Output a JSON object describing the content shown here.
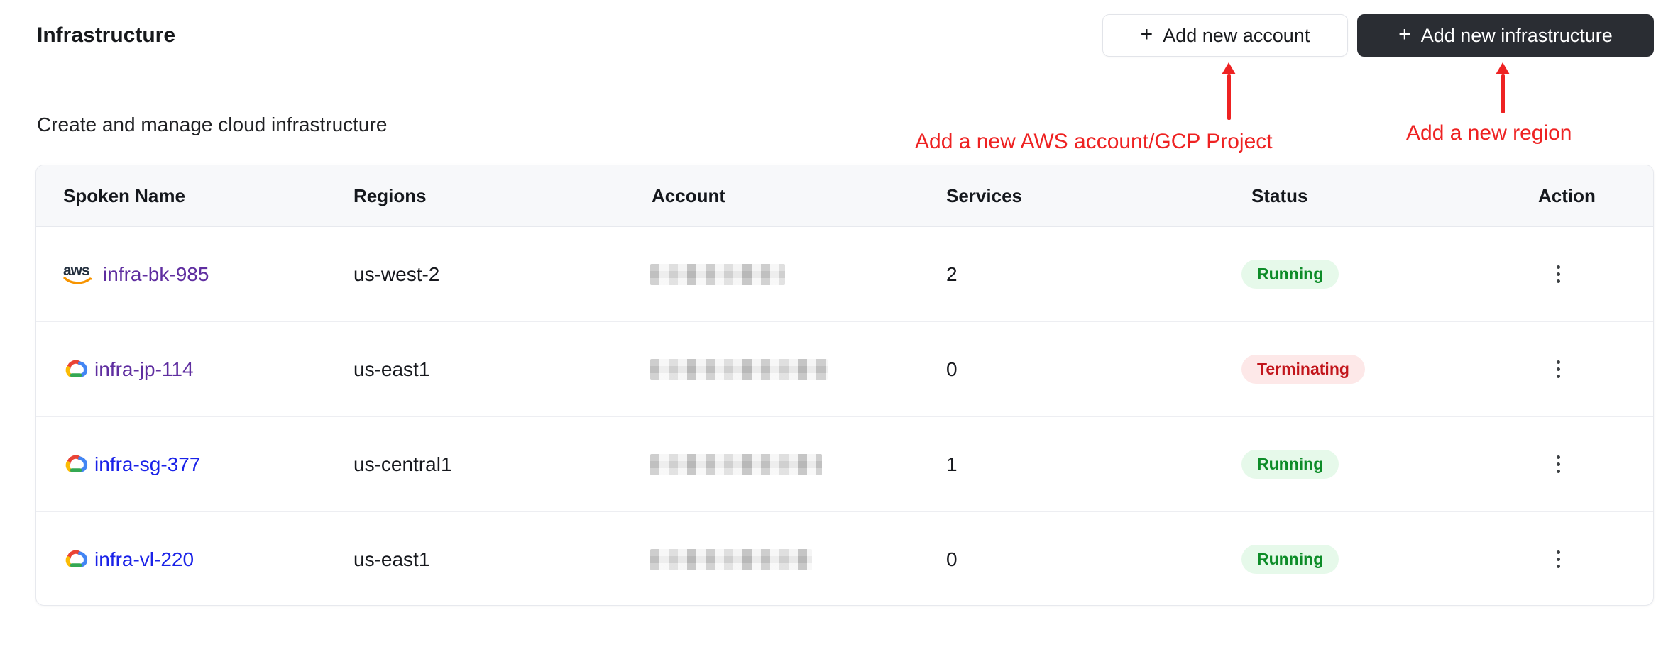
{
  "header": {
    "title": "Infrastructure",
    "plus_icon": "+",
    "add_account_label": "Add new account",
    "add_infrastructure_label": "Add new infrastructure"
  },
  "annotations": {
    "color": "#ee2222",
    "account_note": "Add a new AWS account/GCP Project",
    "region_note": "Add a new region"
  },
  "subtitle": "Create and manage cloud infrastructure",
  "table": {
    "columns": [
      "Spoken Name",
      "Regions",
      "Account",
      "Services",
      "Status",
      "Action"
    ],
    "status_colors": {
      "running_text": "#0d8c28",
      "running_bg": "#e6f9ea",
      "terminating_text": "#c2151b",
      "terminating_bg": "#fde8e8"
    },
    "link_colors": {
      "visited": "#5f2ea0",
      "unvisited": "#1a22e8"
    },
    "rows": [
      {
        "name": "infra-bk-985",
        "provider": "aws",
        "provider_icon": "aws-icon",
        "region": "us-west-2",
        "account_redacted": true,
        "services": "2",
        "status": "Running",
        "action_icon": "kebab-menu-icon"
      },
      {
        "name": "infra-jp-114",
        "provider": "gcp",
        "provider_icon": "gcp-icon",
        "region": "us-east1",
        "account_redacted": true,
        "services": "0",
        "status": "Terminating",
        "action_icon": "kebab-menu-icon"
      },
      {
        "name": "infra-sg-377",
        "provider": "gcp",
        "provider_icon": "gcp-icon",
        "region": "us-central1",
        "account_redacted": true,
        "services": "1",
        "status": "Running",
        "action_icon": "kebab-menu-icon"
      },
      {
        "name": "infra-vl-220",
        "provider": "gcp",
        "provider_icon": "gcp-icon",
        "region": "us-east1",
        "account_redacted": true,
        "services": "0",
        "status": "Running",
        "action_icon": "kebab-menu-icon"
      }
    ]
  }
}
